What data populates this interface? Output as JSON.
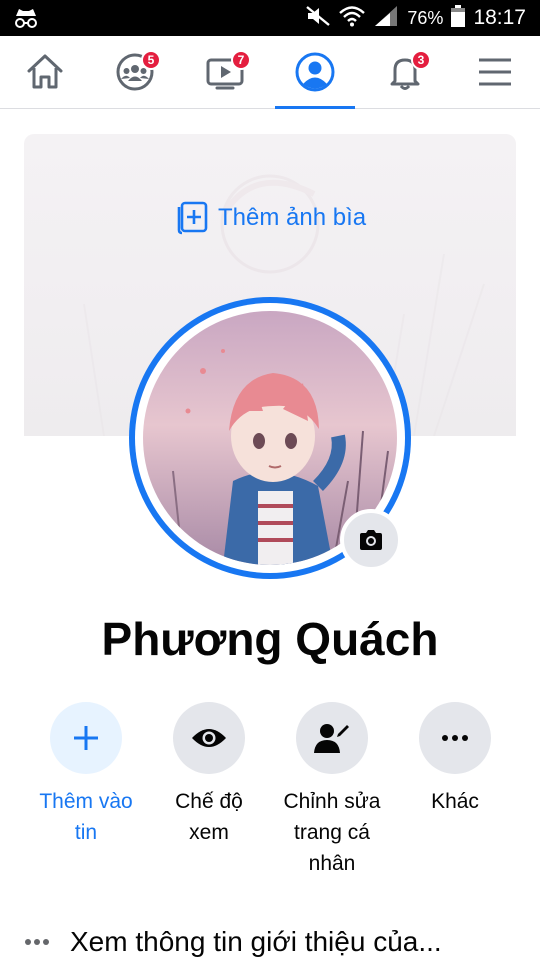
{
  "status_bar": {
    "battery": "76%",
    "time": "18:17"
  },
  "nav": {
    "items": [
      {
        "name": "home",
        "icon": "home-icon",
        "badge": ""
      },
      {
        "name": "groups",
        "icon": "groups-icon",
        "badge": "5"
      },
      {
        "name": "watch",
        "icon": "video-icon",
        "badge": "7"
      },
      {
        "name": "profile",
        "icon": "profile-icon",
        "badge": "",
        "active": true
      },
      {
        "name": "notifications",
        "icon": "bell-icon",
        "badge": "3"
      },
      {
        "name": "menu",
        "icon": "hamburger-menu-icon",
        "badge": ""
      }
    ]
  },
  "cover": {
    "add_cover_label": "Thêm ảnh bìa"
  },
  "profile": {
    "name": "Phương Quách"
  },
  "actions": {
    "add_story": "Thêm vào tin",
    "view_as": "Chế độ xem",
    "edit_profile": "Chỉnh sửa trang cá nhân",
    "more": "Khác"
  },
  "intro": {
    "text": "Xem thông tin giới thiệu của..."
  },
  "colors": {
    "accent": "#1877f2",
    "badge": "#e41e3f",
    "button_bg": "#e4e6eb"
  }
}
